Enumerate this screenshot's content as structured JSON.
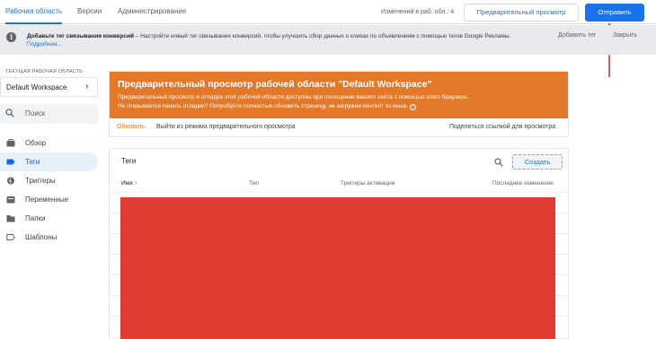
{
  "topbar": {
    "tabs": [
      {
        "label": "Рабочая область",
        "active": true
      },
      {
        "label": "Версии",
        "active": false
      },
      {
        "label": "Администрирование",
        "active": false
      }
    ],
    "changes_label": "Изменений в раб. обл.: 4",
    "preview_button": "Предварительный просмотр",
    "submit_button": "Отправить"
  },
  "notification": {
    "icon": "info-icon",
    "title": "Добавьте тег связывания конверсий",
    "text": " – Настройте новый тег связывания конверсий, чтобы улучшить сбор данных о кликах по объявлениям с помощью тегов Google Рекламы.",
    "more_link": "Подробнее...",
    "add_tag": "Добавить тег",
    "close": "Закрыть"
  },
  "sidebar": {
    "workspace_caption": "ТЕКУЩАЯ РАБОЧАЯ ОБЛАСТЬ",
    "workspace_name": "Default Workspace",
    "search_placeholder": "Поиск",
    "items": [
      {
        "label": "Обзор",
        "icon": "briefcase-icon",
        "active": false
      },
      {
        "label": "Теги",
        "icon": "tag-icon",
        "active": true
      },
      {
        "label": "Триггеры",
        "icon": "trigger-icon",
        "active": false
      },
      {
        "label": "Переменные",
        "icon": "variable-icon",
        "active": false
      },
      {
        "label": "Папки",
        "icon": "folder-icon",
        "active": false
      },
      {
        "label": "Шаблоны",
        "icon": "template-icon",
        "active": false
      }
    ]
  },
  "preview_panel": {
    "title": "Предварительный просмотр рабочей области \"Default Workspace\"",
    "line1": "Предварительный просмотр и отладка этой рабочей области доступны при посещении вашего сайта с помощью этого браузера.",
    "line2": "Не открывается панель отладки? Попробуйте полностью обновить страницу, не загружая контент из кеша.",
    "refresh": "Обновить",
    "exit": "Выйти из режима предварительного просмотра",
    "share": "Поделиться ссылкой для просмотра",
    "accent_color": "#e37828"
  },
  "tags_card": {
    "title": "Теги",
    "create_button": "Создать",
    "columns": [
      "Имя ↑",
      "Тип",
      "Триггеры активации",
      "Последнее изменение"
    ],
    "redaction_color": "#e03a32"
  }
}
